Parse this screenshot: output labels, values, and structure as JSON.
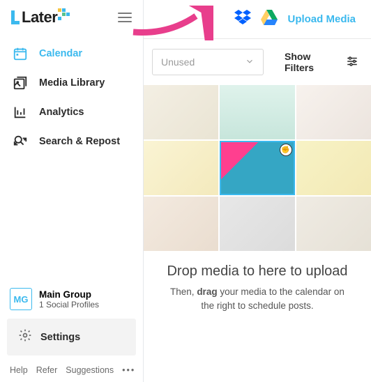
{
  "brand": "Later",
  "nav": {
    "calendar": "Calendar",
    "media_library": "Media Library",
    "analytics": "Analytics",
    "search_repost": "Search & Repost"
  },
  "group": {
    "badge": "MG",
    "name": "Main Group",
    "sub": "1 Social Profiles"
  },
  "settings_label": "Settings",
  "footer": {
    "help": "Help",
    "refer": "Refer",
    "suggestions": "Suggestions"
  },
  "topbar": {
    "upload": "Upload Media"
  },
  "controls": {
    "dropdown": "Unused",
    "filters": "Show Filters"
  },
  "dropzone": {
    "title": "Drop media to here to upload",
    "sub_before": "Then, ",
    "sub_bold": "drag",
    "sub_after": " your media to the calendar on the right to schedule posts."
  }
}
